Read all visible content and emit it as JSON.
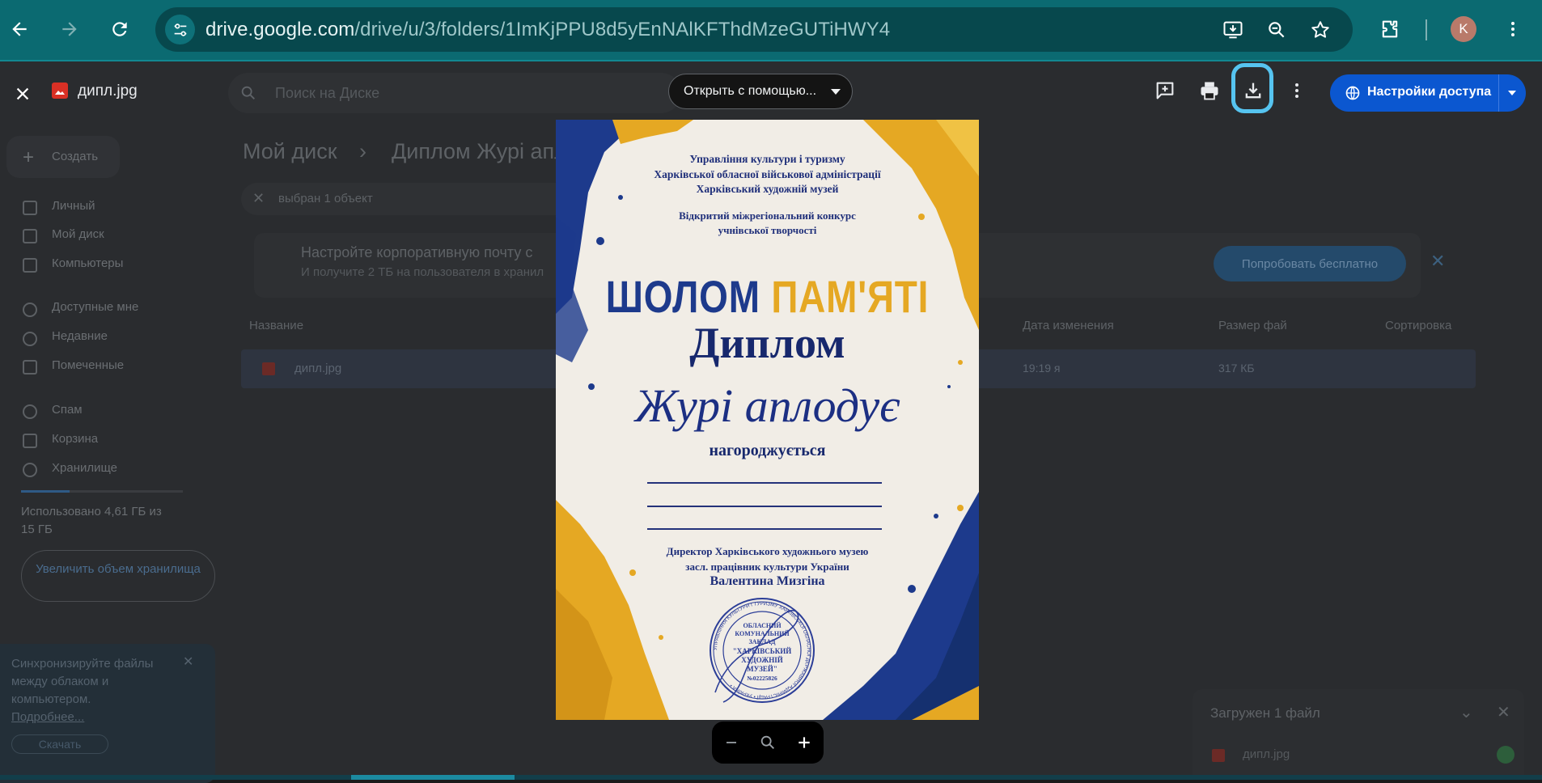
{
  "browser": {
    "url_host": "drive.google.com",
    "url_path": "/drive/u/3/folders/1ImKjPPU8d5yEnNAlKFThdMzeGUTiHWY4",
    "profile_initial": "K"
  },
  "viewer": {
    "file_name": "дипл.jpg",
    "open_with_label": "Открыть с помощью...",
    "share_label": "Настройки доступа"
  },
  "drive": {
    "search_placeholder": "Поиск на Диске",
    "create_label": "Создать",
    "breadcrumb_root": "Мой диск",
    "breadcrumb_sep": "›",
    "breadcrumb_folder": "Диплом Журі апл",
    "selection_text": "выбран 1 объект",
    "nav": [
      "Личный",
      "Мой диск",
      "Компьютеры",
      "Доступные мне",
      "Недавние",
      "Помеченные",
      "Спам",
      "Корзина",
      "Хранилище"
    ],
    "storage_text": "Использовано 4,61 ГБ из 15 ГБ",
    "upgrade_label": "Увеличить объем хранилища",
    "promo_title": "Настройте корпоративную почту с",
    "promo_sub": "И получите 2 ТБ на пользователя в хранил",
    "try_free_label": "Попробовать бесплатно",
    "columns": {
      "name": "Название",
      "modified": "Дата изменения",
      "size": "Размер фай",
      "sort": "Сортировка"
    },
    "file_row": {
      "name": "дипл.jpg",
      "modified": "19:19 я",
      "size": "317 КБ"
    },
    "sync_card": {
      "text": "Синхронизируйте файлы между облаком и компьютером.",
      "link": "Подробнее...",
      "button": "Скачать"
    },
    "upload_panel": {
      "title": "Загружен 1 файл",
      "file": "дипл.jpg"
    }
  },
  "diploma": {
    "org_lines": [
      "Управління культури і туризму",
      "Харківської обласної військової адміністрації",
      "Харківський художній музей"
    ],
    "contest_lines": [
      "Відкритий міжрегіональний конкурс",
      "учнівської творчості"
    ],
    "brand_word1": "ШОЛОМ",
    "brand_word2": "ПАМ'ЯТІ",
    "title": "Диплом",
    "recipient": "Журі аплодує",
    "awarded": "нагороджується",
    "director_lines": [
      "Директор Харківського художнього музею",
      "засл. працівник культури України"
    ],
    "signer": "Валентина Мизгіна",
    "seal_lines": [
      "ОБЛАСНИЙ",
      "КОМУНАЛЬНИЙ",
      "ЗАКЛАД",
      "\"ХАРКІВСЬКИЙ",
      "ХУДОЖНІЙ",
      "МУЗЕЙ\"",
      "№02225826"
    ],
    "seal_ring_text": "УПРАВЛІННЯ КУЛЬТУРИ І ТУРИЗМУ ХАРКІВСЬКОЇ ОБЛАСНОЇ ДЕРЖАВНОЇ АДМІНІСТРАЦІЇ • УКРАЇНА •"
  },
  "colors": {
    "chrome": "#0b6a71",
    "omnibox": "#07484d",
    "share_button": "#0b57d0",
    "download_highlight": "#56c4f0",
    "ukraine_blue": "#1d3a8c",
    "ukraine_yellow": "#e5a823"
  },
  "icons": [
    "back-arrow-icon",
    "forward-arrow-icon",
    "reload-icon",
    "tune-icon",
    "install-app-icon",
    "zoom-icon",
    "star-icon",
    "extensions-icon",
    "more-vert-icon",
    "close-icon",
    "image-file-icon",
    "add-comment-icon",
    "print-icon",
    "download-icon",
    "globe-icon",
    "zoom-out-icon",
    "zoom-reset-icon",
    "zoom-in-icon"
  ]
}
